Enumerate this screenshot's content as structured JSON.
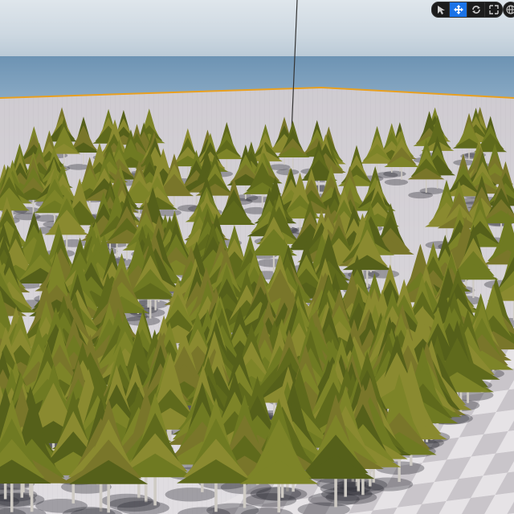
{
  "viewport": {
    "toolbar": {
      "tools": [
        {
          "icon": "select-arrow-icon",
          "active": false
        },
        {
          "icon": "translate-move-icon",
          "active": true
        },
        {
          "icon": "rotate-icon",
          "active": false
        },
        {
          "icon": "scale-icon",
          "active": false
        }
      ],
      "extra_icon": "globe-icon"
    },
    "colors": {
      "active_tool": "#1a73e8",
      "boundary_line": "#e8a020",
      "foliage": "#6f7a22",
      "checker_light": "#e6e3e6",
      "checker_dark": "#c9c5ca"
    }
  }
}
